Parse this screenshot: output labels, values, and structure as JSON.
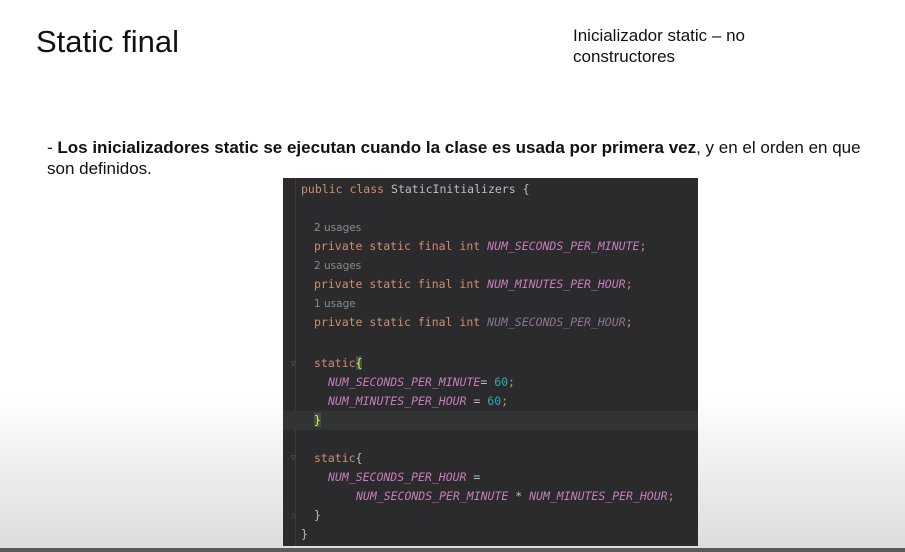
{
  "slide": {
    "title": "Static final",
    "subtitle": "Inicializador static – no constructores",
    "bullet_dash": "- ",
    "bullet_bold": "Los inicializadores static se ejecutan cuando la clase es usada por primera vez",
    "bullet_rest": ", y en el orden en que son definidos."
  },
  "code": {
    "line1_kw": "public class",
    "line1_name": " StaticInitializers {",
    "usage1": "2 usages",
    "usage2": "2 usages",
    "usage3": "1 usage",
    "decl_kw": "private static final int",
    "field1": "NUM_SECONDS_PER_MINUTE",
    "field2": "NUM_MINUTES_PER_HOUR",
    "field3": "NUM_SECONDS_PER_HOUR",
    "semicolon": ";",
    "static_kw": "static",
    "open_brace": "{",
    "close_brace": "}",
    "assign1": "= ",
    "assign2": " = ",
    "assign3": " =",
    "value60": "60",
    "times": " * "
  },
  "colors": {
    "keyword": "#cf8e6d",
    "field": "#c77dbb",
    "number": "#2aacb8",
    "editor_bg": "#2b2b2d"
  }
}
